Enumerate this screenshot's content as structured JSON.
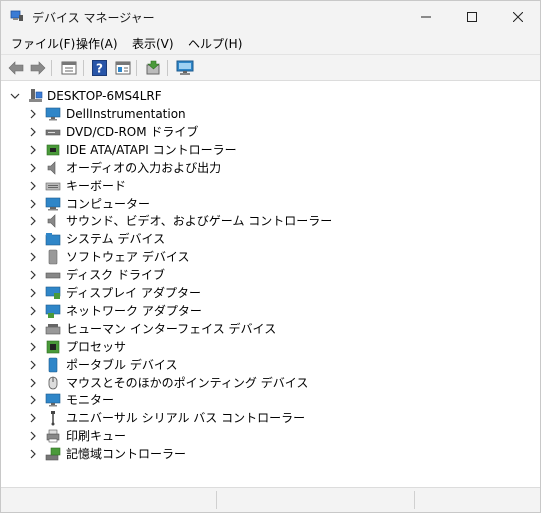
{
  "window": {
    "title": "デバイス マネージャー"
  },
  "menu": [
    {
      "label": "ファイル(F)"
    },
    {
      "label": "操作(A)"
    },
    {
      "label": "表示(V)"
    },
    {
      "label": "ヘルプ(H)"
    }
  ],
  "tree": {
    "root": "DESKTOP-6MS4LRF",
    "items": [
      {
        "label": "DellInstrumentation",
        "icon": "monitor-icon"
      },
      {
        "label": "DVD/CD-ROM ドライブ",
        "icon": "dvd-drive-icon"
      },
      {
        "label": "IDE ATA/ATAPI コントローラー",
        "icon": "controller-chip-icon"
      },
      {
        "label": "オーディオの入力および出力",
        "icon": "speaker-icon"
      },
      {
        "label": "キーボード",
        "icon": "keyboard-icon"
      },
      {
        "label": "コンピューター",
        "icon": "computer-icon"
      },
      {
        "label": "サウンド、ビデオ、およびゲーム コントローラー",
        "icon": "speaker-icon"
      },
      {
        "label": "システム デバイス",
        "icon": "system-folder-icon"
      },
      {
        "label": "ソフトウェア デバイス",
        "icon": "software-device-icon"
      },
      {
        "label": "ディスク ドライブ",
        "icon": "disk-drive-icon"
      },
      {
        "label": "ディスプレイ アダプター",
        "icon": "display-adapter-icon"
      },
      {
        "label": "ネットワーク アダプター",
        "icon": "network-adapter-icon"
      },
      {
        "label": "ヒューマン インターフェイス デバイス",
        "icon": "hid-icon"
      },
      {
        "label": "プロセッサ",
        "icon": "processor-icon"
      },
      {
        "label": "ポータブル デバイス",
        "icon": "portable-device-icon"
      },
      {
        "label": "マウスとそのほかのポインティング デバイス",
        "icon": "mouse-icon"
      },
      {
        "label": "モニター",
        "icon": "monitor-icon"
      },
      {
        "label": "ユニバーサル シリアル バス コントローラー",
        "icon": "usb-icon"
      },
      {
        "label": "印刷キュー",
        "icon": "printer-icon"
      },
      {
        "label": "記憶域コントローラー",
        "icon": "storage-controller-icon"
      }
    ]
  },
  "toolbar": {
    "buttons": [
      "back-arrow-icon",
      "forward-arrow-icon",
      "properties-icon",
      "help-icon",
      "view-icon",
      "update-driver-icon",
      "scan-hardware-icon"
    ]
  },
  "colors": {
    "chrome": "#f3f3f3",
    "icon_blue": "#2f86c8",
    "icon_green": "#4a9a3a"
  }
}
